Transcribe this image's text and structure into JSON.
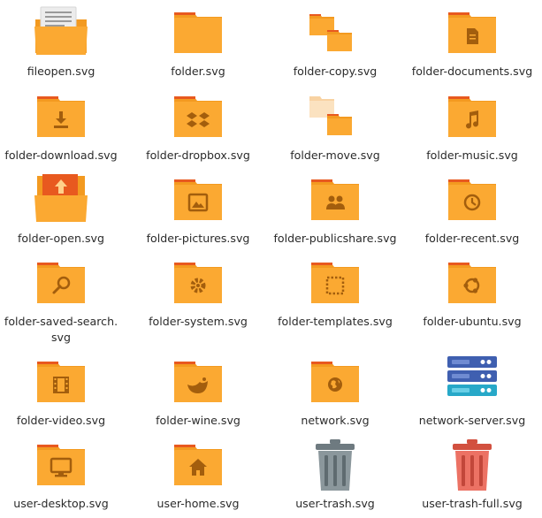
{
  "files": [
    {
      "name": "fileopen.svg",
      "icon": "fileopen-icon"
    },
    {
      "name": "folder.svg",
      "icon": "folder-icon"
    },
    {
      "name": "folder-copy.svg",
      "icon": "folder-copy-icon"
    },
    {
      "name": "folder-documents.svg",
      "icon": "folder-documents-icon"
    },
    {
      "name": "folder-download.svg",
      "icon": "folder-download-icon"
    },
    {
      "name": "folder-dropbox.svg",
      "icon": "folder-dropbox-icon"
    },
    {
      "name": "folder-move.svg",
      "icon": "folder-move-icon"
    },
    {
      "name": "folder-music.svg",
      "icon": "folder-music-icon"
    },
    {
      "name": "folder-open.svg",
      "icon": "folder-open-icon"
    },
    {
      "name": "folder-pictures.svg",
      "icon": "folder-pictures-icon"
    },
    {
      "name": "folder-publicshare.svg",
      "icon": "folder-publicshare-icon"
    },
    {
      "name": "folder-recent.svg",
      "icon": "folder-recent-icon"
    },
    {
      "name": "folder-saved-search.\nsvg",
      "icon": "folder-saved-search-icon"
    },
    {
      "name": "folder-system.svg",
      "icon": "folder-system-icon"
    },
    {
      "name": "folder-templates.svg",
      "icon": "folder-templates-icon"
    },
    {
      "name": "folder-ubuntu.svg",
      "icon": "folder-ubuntu-icon"
    },
    {
      "name": "folder-video.svg",
      "icon": "folder-video-icon"
    },
    {
      "name": "folder-wine.svg",
      "icon": "folder-wine-icon"
    },
    {
      "name": "network.svg",
      "icon": "network-icon"
    },
    {
      "name": "network-server.svg",
      "icon": "network-server-icon"
    },
    {
      "name": "user-desktop.svg",
      "icon": "user-desktop-icon"
    },
    {
      "name": "user-home.svg",
      "icon": "user-home-icon"
    },
    {
      "name": "user-trash.svg",
      "icon": "user-trash-icon"
    },
    {
      "name": "user-trash-full.svg",
      "icon": "user-trash-full-icon"
    }
  ],
  "colors": {
    "folder_body": "#FBA932",
    "folder_back": "#F39A20",
    "folder_tab_stripe": "#E8591F",
    "folder_glyph": "#A35E0D",
    "ghost_folder": "#F8D2A2",
    "server_blue": "#3F5FB0",
    "server_teal": "#27A8C8",
    "trash_grey": "#7E8A8F",
    "trash_red": "#E9675B"
  }
}
